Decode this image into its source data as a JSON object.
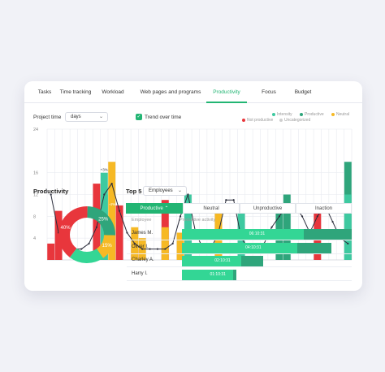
{
  "tabs": [
    "Tasks",
    "Time tracking",
    "Workload",
    "Web pages and programs",
    "Productivity",
    "Focus",
    "Budget"
  ],
  "active_tab": "Productivity",
  "controls": {
    "project_time_label": "Project time",
    "period_value": "days",
    "trend_label": "Trend over time",
    "trend_checked": true
  },
  "legend": [
    {
      "label": "Intensity",
      "color": "#3ec9a0"
    },
    {
      "label": "Productive",
      "color": "#2fa57b"
    },
    {
      "label": "Neutral",
      "color": "#f6b925"
    },
    {
      "label": "Not productive",
      "color": "#e8363c"
    },
    {
      "label": "Uncategorized",
      "color": "#cfcfcf"
    }
  ],
  "chart_data": [
    {
      "type": "bar",
      "title": "",
      "yticks": [
        24,
        16,
        12,
        8,
        4
      ],
      "ylim": [
        0,
        24
      ],
      "grid": true,
      "annotations": [
        "+3%",
        "-4%"
      ],
      "series": [
        {
          "name": "Not productive",
          "color": "#e8363c",
          "values": [
            3,
            9,
            0,
            0,
            0,
            0,
            14,
            0,
            0,
            10,
            0,
            2,
            0,
            0,
            0,
            11,
            0,
            0,
            0,
            0,
            0,
            0,
            0,
            0,
            0,
            0,
            0,
            0,
            0,
            0,
            0,
            0,
            0,
            0,
            0,
            10,
            0,
            0,
            0,
            0
          ]
        },
        {
          "name": "Neutral",
          "color": "#f6b925",
          "values": [
            0,
            0,
            0,
            0,
            0,
            0,
            0,
            0,
            18,
            0,
            0,
            6,
            4,
            0,
            0,
            6,
            0,
            5,
            0,
            0,
            0,
            0,
            10,
            0,
            0,
            0,
            0,
            0,
            0,
            0,
            0,
            0,
            0,
            0,
            0,
            0,
            0,
            0,
            0,
            0
          ]
        },
        {
          "name": "Productive",
          "color": "#2fa57b",
          "values": [
            0,
            0,
            0,
            0,
            0,
            0,
            0,
            12,
            0,
            0,
            0,
            0,
            0,
            0,
            0,
            0,
            0,
            0,
            9,
            0,
            0,
            0,
            0,
            0,
            0,
            0,
            0,
            0,
            0,
            0,
            9,
            12,
            0,
            0,
            0,
            0,
            0,
            0,
            0,
            18
          ]
        },
        {
          "name": "Intensity",
          "color": "#3ec9a0",
          "values": [
            0,
            0,
            0,
            0,
            0,
            0,
            0,
            16,
            0,
            0,
            0,
            0,
            0,
            0,
            0,
            0,
            0,
            0,
            12,
            0,
            0,
            0,
            0,
            0,
            0,
            10,
            0,
            0,
            0,
            0,
            0,
            0,
            0,
            0,
            0,
            0,
            0,
            0,
            0,
            12
          ]
        },
        {
          "name": "Trend over time",
          "color": "#2b2d3b",
          "values": [
            12,
            5,
            2,
            2,
            2,
            3,
            6,
            12,
            14,
            9,
            5,
            3,
            2,
            2,
            2,
            2,
            3,
            8,
            12,
            5,
            2,
            2,
            5,
            11,
            11,
            4,
            2,
            2,
            3,
            6,
            8,
            10,
            10,
            8,
            5,
            8,
            10,
            7,
            4,
            3
          ]
        }
      ]
    },
    {
      "type": "pie",
      "title": "Productivity",
      "labels": [
        "40%",
        "25%",
        "15%"
      ],
      "values": [
        40,
        25,
        15,
        20
      ],
      "colors": [
        "#e8363c",
        "#2fa57b",
        "#f6b925",
        "#33d695"
      ]
    }
  ],
  "productivity": {
    "title": "Productivity"
  },
  "top": {
    "label": "Top 5",
    "dropdown_value": "Employees",
    "category_tabs": [
      "Productive",
      "Neutral",
      "Unproductive",
      "Inaction"
    ],
    "active_category": "Productive",
    "col_employee": "Employee",
    "col_activity": "Productive activity",
    "rows": [
      {
        "name": "James M.",
        "time": "06:10:31",
        "total": 1.0,
        "productive": 0.72
      },
      {
        "name": "Oliver I.",
        "time": "04:10:31",
        "total": 0.88,
        "productive": 0.68
      },
      {
        "name": "Charley A.",
        "time": "02:10:31",
        "total": 0.48,
        "productive": 0.35
      },
      {
        "name": "Harry I.",
        "time": "01:10:31",
        "total": 0.32,
        "productive": 0.3
      }
    ]
  }
}
